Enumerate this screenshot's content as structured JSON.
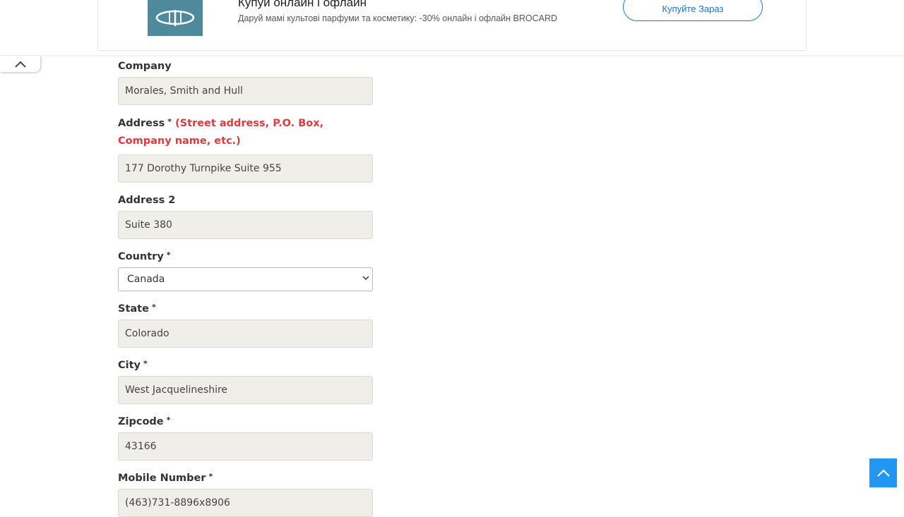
{
  "ad": {
    "title": "Купуй онлайн і офлайн",
    "description": "Даруй мамі культові парфуми та косметику: -30% онлайн і офлайн BROCARD",
    "cta_label": "Купуйте Зараз",
    "logo_icon": "brocard-logo-icon",
    "logo_color": "#4f8a9c",
    "cta_color": "#1a73e8"
  },
  "form": {
    "company": {
      "label": "Company",
      "value": "Morales, Smith and Hull"
    },
    "address": {
      "label": "Address",
      "required_mark": "*",
      "hint": "(Street address, P.O. Box, Company name, etc.)",
      "value": "177 Dorothy Turnpike Suite 955"
    },
    "address2": {
      "label": "Address 2",
      "value": "Suite 380"
    },
    "country": {
      "label": "Country",
      "required_mark": "*",
      "selected": "Canada"
    },
    "state": {
      "label": "State",
      "required_mark": "*",
      "value": "Colorado"
    },
    "city": {
      "label": "City",
      "required_mark": "*",
      "value": "West Jacquelineshire"
    },
    "zipcode": {
      "label": "Zipcode",
      "required_mark": "*",
      "value": "43166"
    },
    "mobile": {
      "label": "Mobile Number",
      "required_mark": "*",
      "value": "(463)731-8896x8906"
    }
  },
  "colors": {
    "hint": "#e03a3e",
    "input_bg": "#f0eee9",
    "scroll_top_bg": "#2196f3"
  },
  "icons": {
    "collapse": "chevron-up-icon",
    "scroll_top": "arrow-up-icon",
    "select": "chevron-down-icon"
  }
}
